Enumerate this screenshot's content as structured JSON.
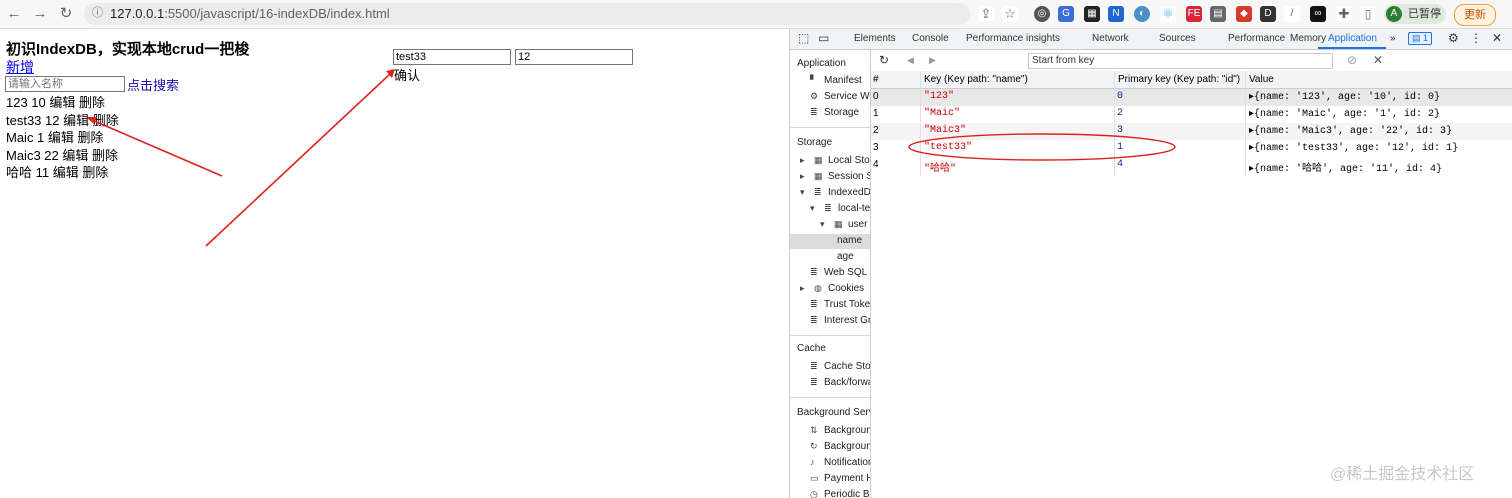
{
  "browser": {
    "url_host": "127.0.0.1",
    "url_path": ":5500/javascript/16-indexDB/index.html",
    "profile_initial": "A",
    "profile_status": "已暂停",
    "update_label": "更新"
  },
  "page": {
    "title": "初识IndexDB，实现本地crud一把梭",
    "add_link": "新增",
    "search_placeholder": "请输入名称",
    "search_button": "点击搜索",
    "rows": [
      {
        "text": "123 10 编辑 删除"
      },
      {
        "text": "test33 12 编辑 删除"
      },
      {
        "text": "Maic 1 编辑 删除"
      },
      {
        "text": "Maic3 22 编辑 删除"
      },
      {
        "text": "哈哈 11 编辑 删除"
      }
    ],
    "edit_name_value": "test33",
    "edit_age_value": "12",
    "confirm_label": "确认"
  },
  "devtools": {
    "tabs": [
      "Elements",
      "Console",
      "Performance insights",
      "Network",
      "Sources",
      "Performance",
      "Memory",
      "Application"
    ],
    "active_tab": "Application",
    "more_tabs": "»",
    "issues_count": "1",
    "sidebar": {
      "application_header": "Application",
      "application_items": [
        "Manifest",
        "Service Wo",
        "Storage"
      ],
      "storage_header": "Storage",
      "storage_items": [
        "Local Stora",
        "Session St",
        "IndexedDB",
        "local-tes",
        "user",
        "name",
        "age",
        "Web SQL",
        "Cookies",
        "Trust Token",
        "Interest Gr"
      ],
      "cache_header": "Cache",
      "cache_items": [
        "Cache Sto",
        "Back/forwa"
      ],
      "bg_header": "Background Serv",
      "bg_items": [
        "Background",
        "Background",
        "Notification",
        "Payment H",
        "Periodic Ba"
      ]
    },
    "start_from_key_placeholder": "Start from key",
    "table": {
      "headers": [
        "#",
        "Key (Key path: \"name\")",
        "Primary key (Key path: \"id\")",
        "Value"
      ],
      "rows": [
        {
          "idx": "0",
          "key": "\"123\"",
          "primary": "0",
          "value": "{name: '123', age: '10', id: 0}"
        },
        {
          "idx": "1",
          "key": "\"Maic\"",
          "primary": "2",
          "value": "{name: 'Maic', age: '1', id: 2}"
        },
        {
          "idx": "2",
          "key": "\"Maic3\"",
          "primary": "3",
          "value": "{name: 'Maic3', age: '22', id: 3}"
        },
        {
          "idx": "3",
          "key": "\"test33\"",
          "primary": "1",
          "value": "{name: 'test33', age: '12', id: 1}"
        },
        {
          "idx": "4",
          "key": "\"哈哈\"",
          "primary": "4",
          "value": "{name: '哈哈', age: '11', id: 4}"
        }
      ]
    }
  },
  "watermark": "@稀土掘金技术社区",
  "colors": {
    "link": "#0000ee",
    "accent": "#1a73e8",
    "annotation": "#e0201e",
    "string": "#c80000",
    "number": "#1a1aa6"
  }
}
